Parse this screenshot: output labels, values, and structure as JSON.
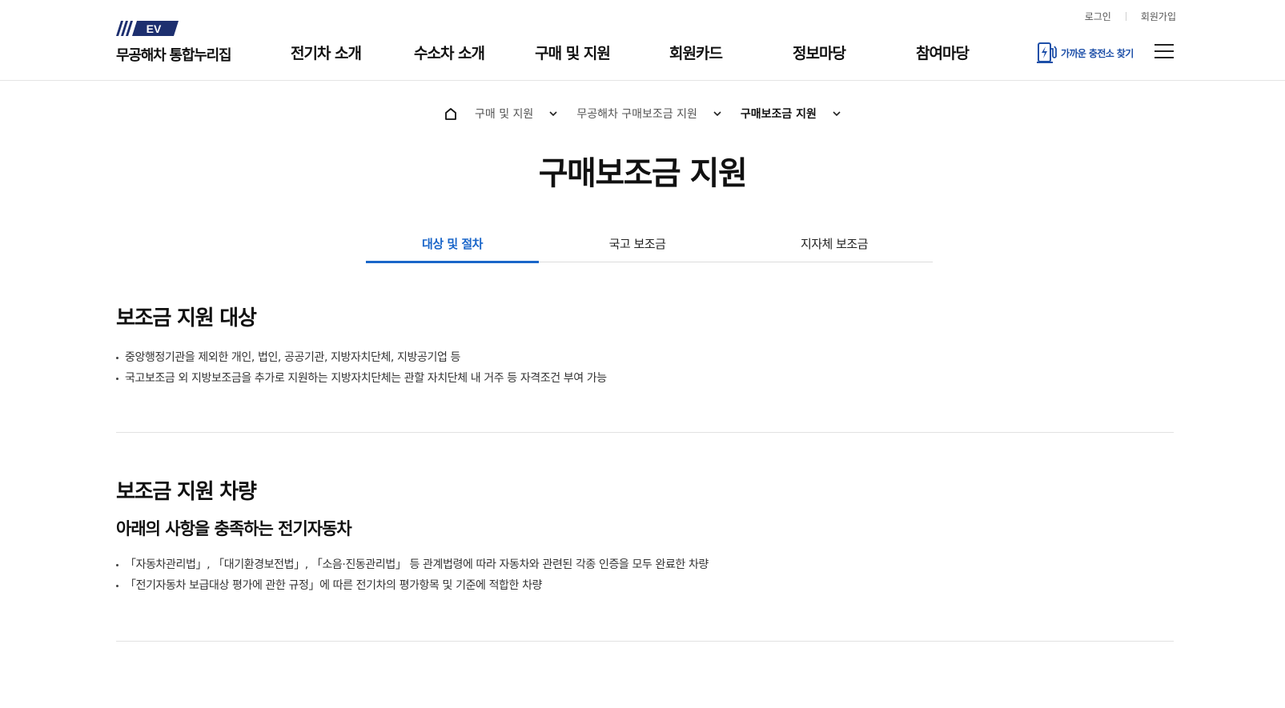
{
  "util": {
    "login": "로그인",
    "signup": "회원가입"
  },
  "logo": {
    "badge": "EV",
    "text": "무공해차 통합누리집"
  },
  "gnb": [
    {
      "label": "전기차 소개"
    },
    {
      "label": "수소차 소개"
    },
    {
      "label": "구매 및 지원"
    },
    {
      "label": "회원카드"
    },
    {
      "label": "정보마당"
    },
    {
      "label": "참여마당"
    }
  ],
  "charger": {
    "label": "가까운 충전소 찾기",
    "icon": "charging-station-icon"
  },
  "colors": {
    "accent": "#1a66c9",
    "brand_navy": "#1d2f6f"
  },
  "breadcrumb": [
    {
      "label": "구매 및 지원"
    },
    {
      "label": "무공해차 구매보조금 지원"
    },
    {
      "label": "구매보조금 지원"
    }
  ],
  "page_title": "구매보조금 지원",
  "tabs": [
    {
      "label": "대상 및 절차",
      "active": true
    },
    {
      "label": "국고 보조금",
      "active": false
    },
    {
      "label": "지자체 보조금",
      "active": false
    }
  ],
  "sections": [
    {
      "title": "보조금 지원 대상",
      "items": [
        "중앙행정기관을 제외한 개인, 법인, 공공기관, 지방자치단체, 지방공기업 등",
        "국고보조금 외 지방보조금을 추가로 지원하는 지방자치단체는 관할 자치단체 내 거주 등 자격조건 부여 가능"
      ]
    },
    {
      "title": "보조금 지원 차량",
      "subtitle": "아래의 사항을 충족하는 전기자동차",
      "items": [
        "「자동차관리법」, 「대기환경보전법」, 「소음·진동관리법」 등 관계법령에 따라 자동차와 관련된 각종 인증을 모두 완료한 차량",
        "「전기자동차 보급대상 평가에 관한 규정」에 따른 전기차의 평가항목 및 기준에 적합한 차량"
      ]
    }
  ]
}
